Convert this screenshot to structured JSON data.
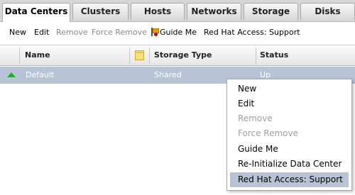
{
  "tabs": [
    "Data Centers",
    "Clusters",
    "Hosts",
    "Networks",
    "Storage",
    "Disks"
  ],
  "toolbar": {
    "new": "New",
    "edit": "Edit",
    "remove": "Remove",
    "force_remove": "Force Remove",
    "guide_me": "Guide Me",
    "support": "Red Hat Access: Support"
  },
  "grid": {
    "headers": {
      "name": "Name",
      "storage_type": "Storage Type",
      "status": "Status"
    },
    "rows": [
      {
        "name": "Default",
        "storage_type": "Shared",
        "status": "Up"
      }
    ]
  },
  "context_menu": {
    "items": [
      {
        "label": "New",
        "enabled": true
      },
      {
        "label": "Edit",
        "enabled": true
      },
      {
        "label": "Remove",
        "enabled": false
      },
      {
        "label": "Force Remove",
        "enabled": false
      },
      {
        "label": "Guide Me",
        "enabled": true
      },
      {
        "label": "Re-Initialize Data Center",
        "enabled": true
      },
      {
        "label": "Red Hat Access: Support",
        "enabled": true,
        "highlighted": true
      }
    ]
  },
  "colors": {
    "selection": "#b8c4d6",
    "status_up": "#22b022"
  }
}
